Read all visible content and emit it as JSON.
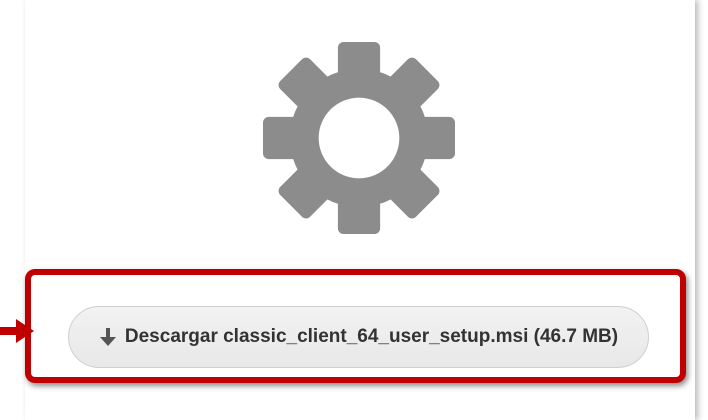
{
  "icons": {
    "gear": "gear-icon",
    "download": "download-arrow-icon",
    "pointer": "pointer-arrow-icon"
  },
  "colors": {
    "highlight": "#c00000",
    "gear": "#8c8c8c",
    "button_bg": "#eeeeee",
    "button_text": "#333333"
  },
  "download_button": {
    "label": "Descargar classic_client_64_user_setup.msi (46.7 MB)"
  }
}
